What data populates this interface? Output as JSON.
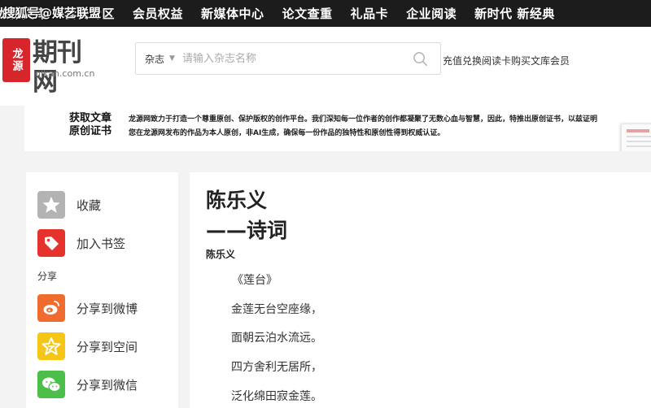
{
  "topnav": {
    "watermark": "搜狐号@媒艺联盟",
    "items": [
      "龙源文库",
      "套餐专区",
      "会员权益",
      "新媒体中心",
      "论文查重",
      "礼品卡",
      "企业阅读",
      "新时代 新经典"
    ]
  },
  "header": {
    "logo": {
      "seal": "龙源",
      "brand": "期刊网",
      "domain": "qikan.com.cn"
    },
    "search": {
      "category": "杂志",
      "placeholder": "请输入杂志名称"
    },
    "links": "充值兑换阅读卡购买文库会员"
  },
  "banner": {
    "title": "获取文章原创证书",
    "text": "龙源网致力于打造一个尊重原创、保护版权的创作平台。我们深知每一位作者的创作都凝聚了无数心血与智慧，因此，特推出原创证书，以兹证明您在龙源网发布的作品为本人原创，非AI生成，确保每一份作品的独特性和原创性得到权威认证。"
  },
  "sidebar": {
    "favorite": "收藏",
    "bookmark": "加入书签",
    "share_label": "分享",
    "share_weibo": "分享到微博",
    "share_qzone": "分享到空间",
    "share_wechat": "分享到微信"
  },
  "article": {
    "title_line1": "陈乐义",
    "title_line2": "——诗词",
    "author": "陈乐义",
    "poem": [
      "《莲台》",
      "金莲无台空座缘，",
      "面朝云泊水流远。",
      "四方舍利无居所，",
      "泛化绵田寂金莲。"
    ]
  },
  "colors": {
    "nav_bg": "#1c1c1c",
    "logo_red": "#d6262b",
    "favorite_grey": "#b3b3b3",
    "bookmark_red": "#e5322d",
    "weibo_orange": "#f06b2e",
    "qzone_yellow": "#f5c518",
    "wechat_green": "#4cbe4a"
  },
  "icons": {
    "favorite": "star-icon",
    "bookmark": "tag-icon",
    "weibo": "weibo-icon",
    "qzone": "qzone-star-icon",
    "wechat": "wechat-icon",
    "search": "search-icon"
  }
}
